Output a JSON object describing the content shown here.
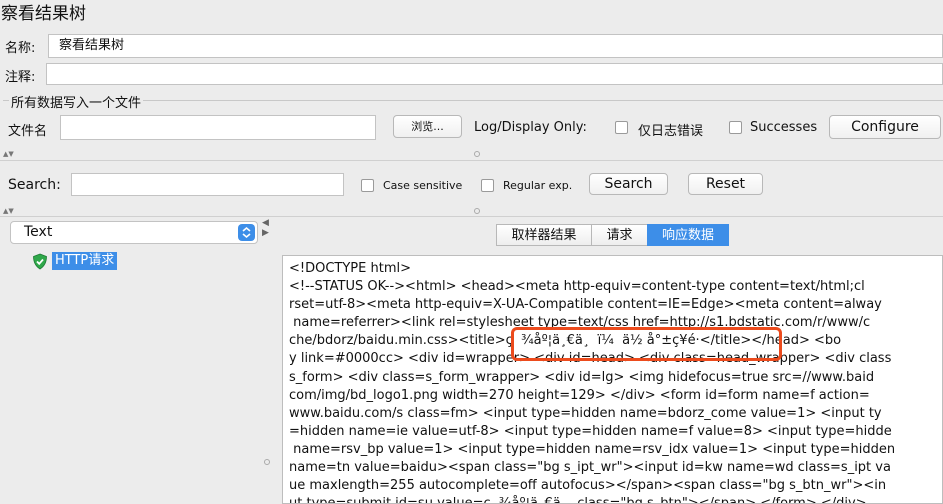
{
  "window_title": "察看结果树",
  "name_row": {
    "label": "名称:",
    "value": "察看结果树"
  },
  "comment_row": {
    "label": "注释:"
  },
  "file_group": {
    "legend": "所有数据写入一个文件",
    "filename_label": "文件名",
    "browse_button": "浏览...",
    "log_display_label": "Log/Display Only:",
    "errors_only_label": "仅日志错误",
    "successes_label": "Successes",
    "configure_button": "Configure"
  },
  "search_bar": {
    "label": "Search:",
    "case_sensitive_label": "Case sensitive",
    "regex_label": "Regular exp.",
    "search_button": "Search",
    "reset_button": "Reset"
  },
  "renderer_select": {
    "value": "Text"
  },
  "tree": {
    "items": [
      {
        "label": "HTTP请求",
        "status": "success",
        "selected": true
      }
    ]
  },
  "tabs": [
    {
      "label": "取样器结果",
      "active": false
    },
    {
      "label": "请求",
      "active": false
    },
    {
      "label": "响应数据",
      "active": true
    }
  ],
  "response_lines": [
    "<!DOCTYPE html>",
    "<!--STATUS OK--><html> <head><meta http-equiv=content-type content=text/html;cl",
    "rset=utf-8><meta http-equiv=X-UA-Compatible content=IE=Edge><meta content=alway",
    " name=referrer><link rel=stylesheet type=text/css href=http://s1.bdstatic.com/r/www/c",
    "che/bdorz/baidu.min.css><title>ç  ¾åº¦ä¸€ä¸  ï¼  ä½ å°±ç¥é·</title></head> <bo",
    "y link=#0000cc> <div id=wrapper> <div id=head> <div class=head_wrapper> <div class",
    "s_form> <div class=s_form_wrapper> <div id=lg> <img hidefocus=true src=//www.baid",
    "com/img/bd_logo1.png width=270 height=129> </div> <form id=form name=f action=",
    "www.baidu.com/s class=fm> <input type=hidden name=bdorz_come value=1> <input ty",
    "=hidden name=ie value=utf-8> <input type=hidden name=f value=8> <input type=hidde",
    " name=rsv_bp value=1> <input type=hidden name=rsv_idx value=1> <input type=hidden",
    "name=tn value=baidu><span class=\"bg s_ipt_wr\"><input id=kw name=wd class=s_ipt va",
    "ue maxlength=255 autocomplete=off autofocus></span><span class=\"bg s_btn_wr\"><in",
    "ut type=submit id=su value=ç  ¾åº¦ä¸€ä    class=\"bg s_btn\"></span> </form> </div>"
  ],
  "colors": {
    "accent": "#3d8ee8",
    "highlight_box": "#ec4b1d",
    "success_shield": "#2fa84a",
    "window_bg": "#ececec"
  },
  "icons": {
    "dropdown": "chevron-updown-icon",
    "tree_status": "shield-check-icon"
  }
}
